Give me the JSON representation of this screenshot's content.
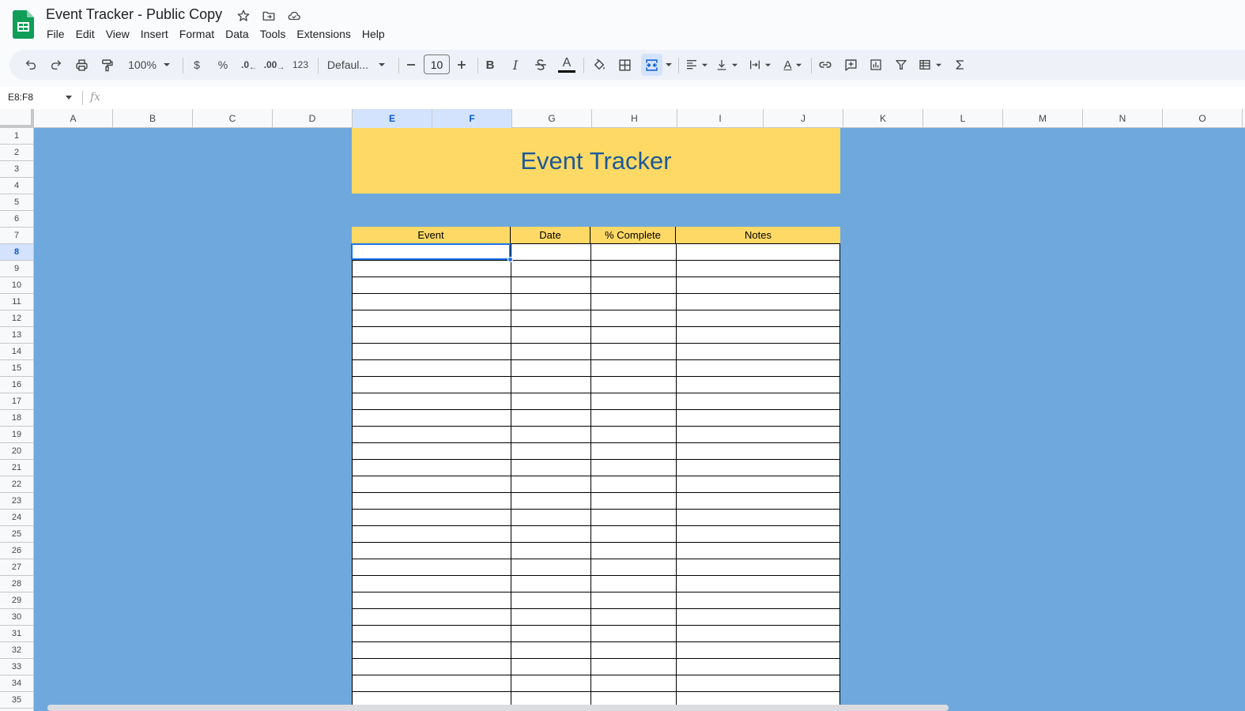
{
  "app": {
    "title": "Event Tracker - Public Copy"
  },
  "menu": [
    "File",
    "Edit",
    "View",
    "Insert",
    "Format",
    "Data",
    "Tools",
    "Extensions",
    "Help"
  ],
  "toolbar": {
    "zoom": "100%",
    "currency": "$",
    "percent": "%",
    "decrease_decimal": ".0",
    "increase_decimal": ".00",
    "number_format": "123",
    "font": "Defaul...",
    "font_size": "10",
    "bold": "B",
    "italic": "I",
    "text_color_glyph": "A",
    "rotate_glyph": "A"
  },
  "formula_bar": {
    "name_box": "E8:F8",
    "fx": "fx"
  },
  "columns": [
    "A",
    "B",
    "C",
    "D",
    "E",
    "F",
    "G",
    "H",
    "I",
    "J",
    "K",
    "L",
    "M",
    "N",
    "O"
  ],
  "selected_columns": [
    "E",
    "F"
  ],
  "rows": [
    "1",
    "2",
    "3",
    "4",
    "5",
    "6",
    "7",
    "8",
    "9",
    "10",
    "11",
    "12",
    "13",
    "14",
    "15",
    "16",
    "17",
    "18",
    "19",
    "20",
    "21",
    "22",
    "23",
    "24",
    "25",
    "26",
    "27",
    "28",
    "29",
    "30",
    "31",
    "32",
    "33",
    "34",
    "35"
  ],
  "selected_row": "8",
  "sheet": {
    "title": "Event Tracker",
    "headers": [
      "Event",
      "Date",
      "% Complete",
      "Notes"
    ]
  },
  "colors": {
    "background_fill": "#6fa8dc",
    "header_fill": "#ffd966",
    "title_text": "#1c5a96",
    "selection": "#1a73e8"
  }
}
